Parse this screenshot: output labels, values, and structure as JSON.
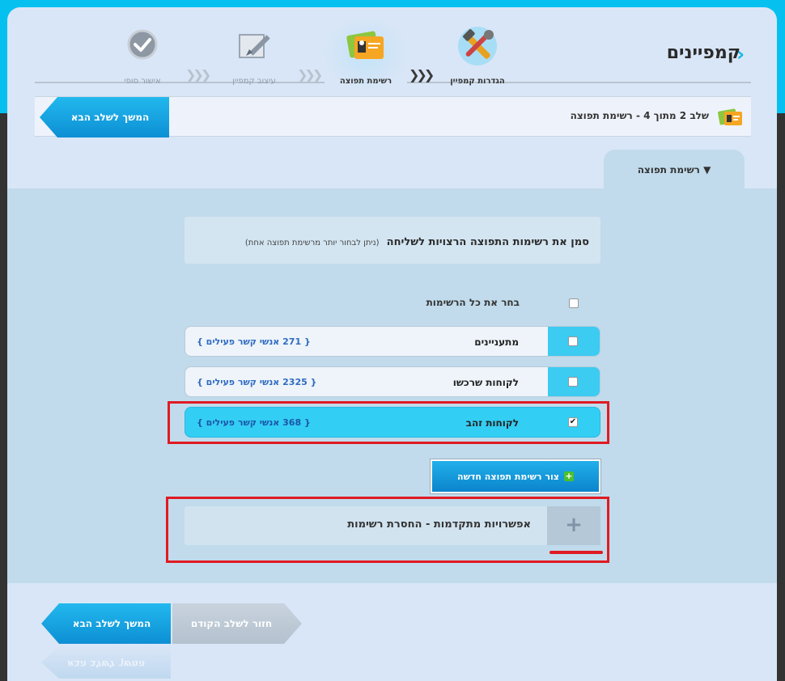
{
  "header": {
    "title": "קמפיינים"
  },
  "steps": [
    {
      "label": "הגדרות קמפיין",
      "state": "active",
      "icon": "tools-icon"
    },
    {
      "label": "רשימת תפוצה",
      "state": "current",
      "icon": "contact-cards-icon"
    },
    {
      "label": "עיצוב קמפיין",
      "state": "inactive",
      "icon": "design-pen-icon"
    },
    {
      "label": "אישור סופי",
      "state": "inactive",
      "icon": "checkmark-circle-icon"
    }
  ],
  "stepbar": {
    "text": "שלב 2 מתוך 4 - רשימת תפוצה",
    "next_label": "המשך לשלב הבא"
  },
  "tab": {
    "label": "רשימת תפוצה"
  },
  "instructions": {
    "main": "סמן את רשימות התפוצה הרצויות לשליחה",
    "note": "(ניתן לבחור יותר מרשימת תפוצה אחת)"
  },
  "select_all": {
    "label": "בחר את כל הרשימות",
    "checked": false
  },
  "lists": [
    {
      "name": "מתעניינים",
      "count_text": "{ 271 אנשי קשר פעילים }",
      "checked": false
    },
    {
      "name": "לקוחות שרכשו",
      "count_text": "{ 2325 אנשי קשר פעילים }",
      "checked": false
    },
    {
      "name": "לקוחות זהב",
      "count_text": "{ 368 אנשי קשר פעילים }",
      "checked": true
    }
  ],
  "new_list_button": {
    "label": "צור רשימת תפוצה חדשה"
  },
  "advanced": {
    "label": "אפשרויות מתקדמות - החסרת רשימות"
  },
  "footer": {
    "back_label": "חזור לשלב הקודם",
    "next_label": "המשך לשלב הבא"
  },
  "colors": {
    "accent": "#06c0f0",
    "button": "#0d8fd4",
    "highlight": "#e01a22"
  }
}
